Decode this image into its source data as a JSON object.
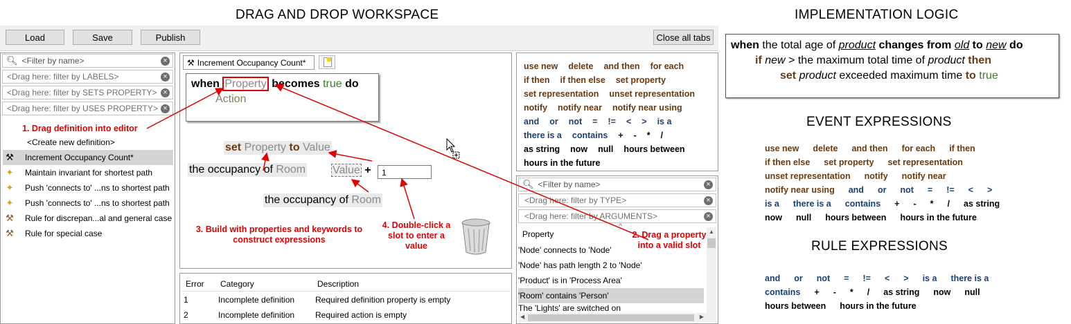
{
  "titles": {
    "workspace": "DRAG AND  DROP WORKSPACE",
    "logic": "IMPLEMENTATION LOGIC",
    "event": "EVENT EXPRESSIONS",
    "rule": "RULE EXPRESSIONS"
  },
  "toolbar": {
    "load": "Load",
    "save": "Save",
    "publish": "Publish",
    "close_all": "Close all tabs"
  },
  "left_filters": {
    "name": "<Filter by name>",
    "labels": "<Drag here: filter by LABELS>",
    "sets": "<Drag here: filter by SETS PROPERTY>",
    "uses": "<Drag here: filter by USES PROPERTY>"
  },
  "definitions": {
    "create_new": "<Create new definition>",
    "items": [
      {
        "label": "Increment Occupancy Count*",
        "icon": "wrench-icon"
      },
      {
        "label": "Maintain invariant for shortest path",
        "icon": "broom-icon"
      },
      {
        "label": "Push 'connects to' ...ns to shortest path",
        "icon": "broom-icon"
      },
      {
        "label": "Push 'connects to' ...ns to shortest path",
        "icon": "broom-icon"
      },
      {
        "label": "Rule for discrepan...al and general case",
        "icon": "gavel-icon"
      },
      {
        "label": "Rule for special case",
        "icon": "gavel-icon"
      }
    ]
  },
  "editor": {
    "tab_label": "Increment Occupancy Count*",
    "when": "when",
    "property": "Property",
    "becomes": "becomes",
    "true_kw": "true",
    "do": "do",
    "action": "Action",
    "set": "set",
    "set_property": "Property",
    "to": "to",
    "value": "Value",
    "occ1_prefix": "the occupancy of",
    "occ1_room": "Room",
    "value_slot": "Value",
    "plus": "+",
    "number_input": "1",
    "occ2_prefix": "the occupancy of",
    "occ2_room": "Room"
  },
  "annotations": {
    "a1": "1. Drag definition into editor",
    "a2": "2. Drag a property into a valid slot",
    "a3": "3. Build with properties and keywords to construct expressions",
    "a4": "4. Double-click a slot to enter a value"
  },
  "errors": {
    "headers": [
      "Error",
      "Category",
      "Description"
    ],
    "rows": [
      [
        "1",
        "Incomplete definition",
        "Required definition property is empty"
      ],
      [
        "2",
        "Incomplete definition",
        "Required action is empty"
      ]
    ]
  },
  "palette": {
    "rows": [
      [
        {
          "t": "use new",
          "c": "kw"
        },
        {
          "t": "delete",
          "c": "kw"
        },
        {
          "t": "and then",
          "c": "kw"
        },
        {
          "t": "for each",
          "c": "kw"
        }
      ],
      [
        {
          "t": "if then",
          "c": "kw"
        },
        {
          "t": "if then else",
          "c": "kw"
        },
        {
          "t": "set property",
          "c": "kw"
        }
      ],
      [
        {
          "t": "set representation",
          "c": "kw"
        },
        {
          "t": "unset representation",
          "c": "kw"
        }
      ],
      [
        {
          "t": "notify",
          "c": "kw"
        },
        {
          "t": "notify near",
          "c": "kw"
        },
        {
          "t": "notify near using",
          "c": "kw"
        }
      ],
      [
        {
          "t": "and",
          "c": "kwb"
        },
        {
          "t": "or",
          "c": "kwb"
        },
        {
          "t": "not",
          "c": "kwb"
        },
        {
          "t": "=",
          "c": "kwb"
        },
        {
          "t": "!=",
          "c": "kwb"
        },
        {
          "t": "<",
          "c": "kwb"
        },
        {
          "t": ">",
          "c": "kwb"
        },
        {
          "t": "is a",
          "c": "kwb"
        }
      ],
      [
        {
          "t": "there is a",
          "c": "kwb"
        },
        {
          "t": "contains",
          "c": "kwb"
        },
        {
          "t": "+",
          "c": "kwk"
        },
        {
          "t": "-",
          "c": "kwk"
        },
        {
          "t": "*",
          "c": "kwk"
        },
        {
          "t": "/",
          "c": "kwk"
        }
      ],
      [
        {
          "t": "as string",
          "c": "kwk"
        },
        {
          "t": "now",
          "c": "kwk"
        },
        {
          "t": "null",
          "c": "kwk"
        },
        {
          "t": "hours between",
          "c": "kwk"
        }
      ],
      [
        {
          "t": "hours in the future",
          "c": "kwk"
        }
      ]
    ]
  },
  "prop_filters": {
    "name": "<Filter by name>",
    "type": "<Drag here: filter by TYPE>",
    "args": "<Drag here: filter by ARGUMENTS>"
  },
  "properties": {
    "header": "Property",
    "items": [
      "'Node' connects to 'Node'",
      "'Node' has path length 2 to 'Node'",
      "'Product' is in 'Process Area'",
      "'Room' contains 'Person'",
      "The 'Lights' are switched on"
    ]
  },
  "logic": {
    "l1": {
      "when": "when",
      "t1": "the total age of",
      "product": "product",
      "changes": "changes from",
      "old": "old",
      "to": "to",
      "new": "new",
      "do": "do"
    },
    "l2": {
      "if": "if",
      "new": "new",
      "gt": ">",
      "t2": "the maximum total time of",
      "product": "product",
      "then": "then"
    },
    "l3": {
      "set": "set",
      "product": "product",
      "t3": "exceeded maximum time",
      "to": "to",
      "true": "true"
    }
  },
  "event_expr": {
    "rows": [
      [
        {
          "t": "use new",
          "c": "kw"
        },
        {
          "t": "delete",
          "c": "kw"
        },
        {
          "t": "and then",
          "c": "kw"
        },
        {
          "t": "for each",
          "c": "kw"
        },
        {
          "t": "if then",
          "c": "kw"
        }
      ],
      [
        {
          "t": "if then else",
          "c": "kw"
        },
        {
          "t": "set property",
          "c": "kw"
        },
        {
          "t": "set representation",
          "c": "kw"
        }
      ],
      [
        {
          "t": "unset representation",
          "c": "kw"
        },
        {
          "t": "notify",
          "c": "kw"
        },
        {
          "t": "notify near",
          "c": "kw"
        }
      ],
      [
        {
          "t": "notify near using",
          "c": "kw"
        },
        {
          "t": "and",
          "c": "kwb"
        },
        {
          "t": "or",
          "c": "kwb"
        },
        {
          "t": "not",
          "c": "kwb"
        },
        {
          "t": "=",
          "c": "kwb"
        },
        {
          "t": "!=",
          "c": "kwb"
        },
        {
          "t": "<",
          "c": "kwb"
        },
        {
          "t": ">",
          "c": "kwb"
        }
      ],
      [
        {
          "t": "is a",
          "c": "kwb"
        },
        {
          "t": "there is a",
          "c": "kwb"
        },
        {
          "t": "contains",
          "c": "kwb"
        },
        {
          "t": "+",
          "c": "kwk"
        },
        {
          "t": "-",
          "c": "kwk"
        },
        {
          "t": "*",
          "c": "kwk"
        },
        {
          "t": "/",
          "c": "kwk"
        },
        {
          "t": "as string",
          "c": "kwk"
        }
      ],
      [
        {
          "t": "now",
          "c": "kwk"
        },
        {
          "t": "null",
          "c": "kwk"
        },
        {
          "t": "hours between",
          "c": "kwk"
        },
        {
          "t": "hours in the future",
          "c": "kwk"
        }
      ]
    ]
  },
  "rule_expr": {
    "rows": [
      [
        {
          "t": "and",
          "c": "kwb"
        },
        {
          "t": "or",
          "c": "kwb"
        },
        {
          "t": "not",
          "c": "kwb"
        },
        {
          "t": "=",
          "c": "kwb"
        },
        {
          "t": "!=",
          "c": "kwb"
        },
        {
          "t": "<",
          "c": "kwb"
        },
        {
          "t": ">",
          "c": "kwb"
        },
        {
          "t": "is a",
          "c": "kwb"
        },
        {
          "t": "there is a",
          "c": "kwb"
        }
      ],
      [
        {
          "t": "contains",
          "c": "kwb"
        },
        {
          "t": "+",
          "c": "kwk"
        },
        {
          "t": "-",
          "c": "kwk"
        },
        {
          "t": "*",
          "c": "kwk"
        },
        {
          "t": "/",
          "c": "kwk"
        },
        {
          "t": "as string",
          "c": "kwk"
        },
        {
          "t": "now",
          "c": "kwk"
        },
        {
          "t": "null",
          "c": "kwk"
        }
      ],
      [
        {
          "t": "hours between",
          "c": "kwk"
        },
        {
          "t": "hours in the future",
          "c": "kwk"
        }
      ]
    ]
  }
}
